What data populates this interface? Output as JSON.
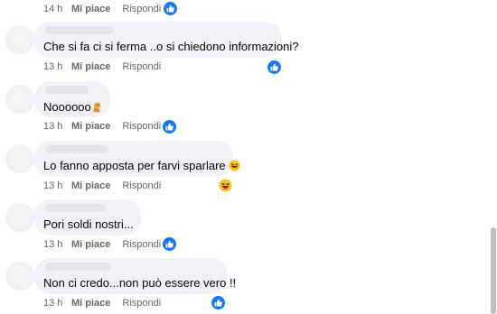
{
  "comments": [
    {
      "text": "",
      "time": "14 h",
      "like_label": "Mi piace",
      "reply_label": "Rispondi",
      "reaction": "like-icon"
    },
    {
      "text": "Che si fa ci si ferma ..o si chiedono informazioni?",
      "time": "13 h",
      "like_label": "Mi piace",
      "reply_label": "Rispondi",
      "reaction": "like-icon"
    },
    {
      "text": "Noooooo",
      "emoji": "person-facepalm-emoji",
      "time": "13 h",
      "like_label": "Mi piace",
      "reply_label": "Rispondi",
      "reaction": "like-icon"
    },
    {
      "text": "Lo fanno apposta per farvi sparlare",
      "emoji": "laughing-emoji",
      "time": "13 h",
      "like_label": "Mi piace",
      "reply_label": "Rispondi",
      "reaction": "laughing-emoji"
    },
    {
      "text": "Pori soldi nostri...",
      "time": "13 h",
      "like_label": "Mi piace",
      "reply_label": "Rispondi",
      "reaction": "like-icon"
    },
    {
      "text": "Non ci credo...non può essere vero !!",
      "time": "13 h",
      "like_label": "Mi piace",
      "reply_label": "Rispondi",
      "reaction": "like-icon"
    }
  ],
  "colors": {
    "bubble": "#f0f2f5",
    "meta_text": "#65676b",
    "like_blue": "#1877f2"
  }
}
